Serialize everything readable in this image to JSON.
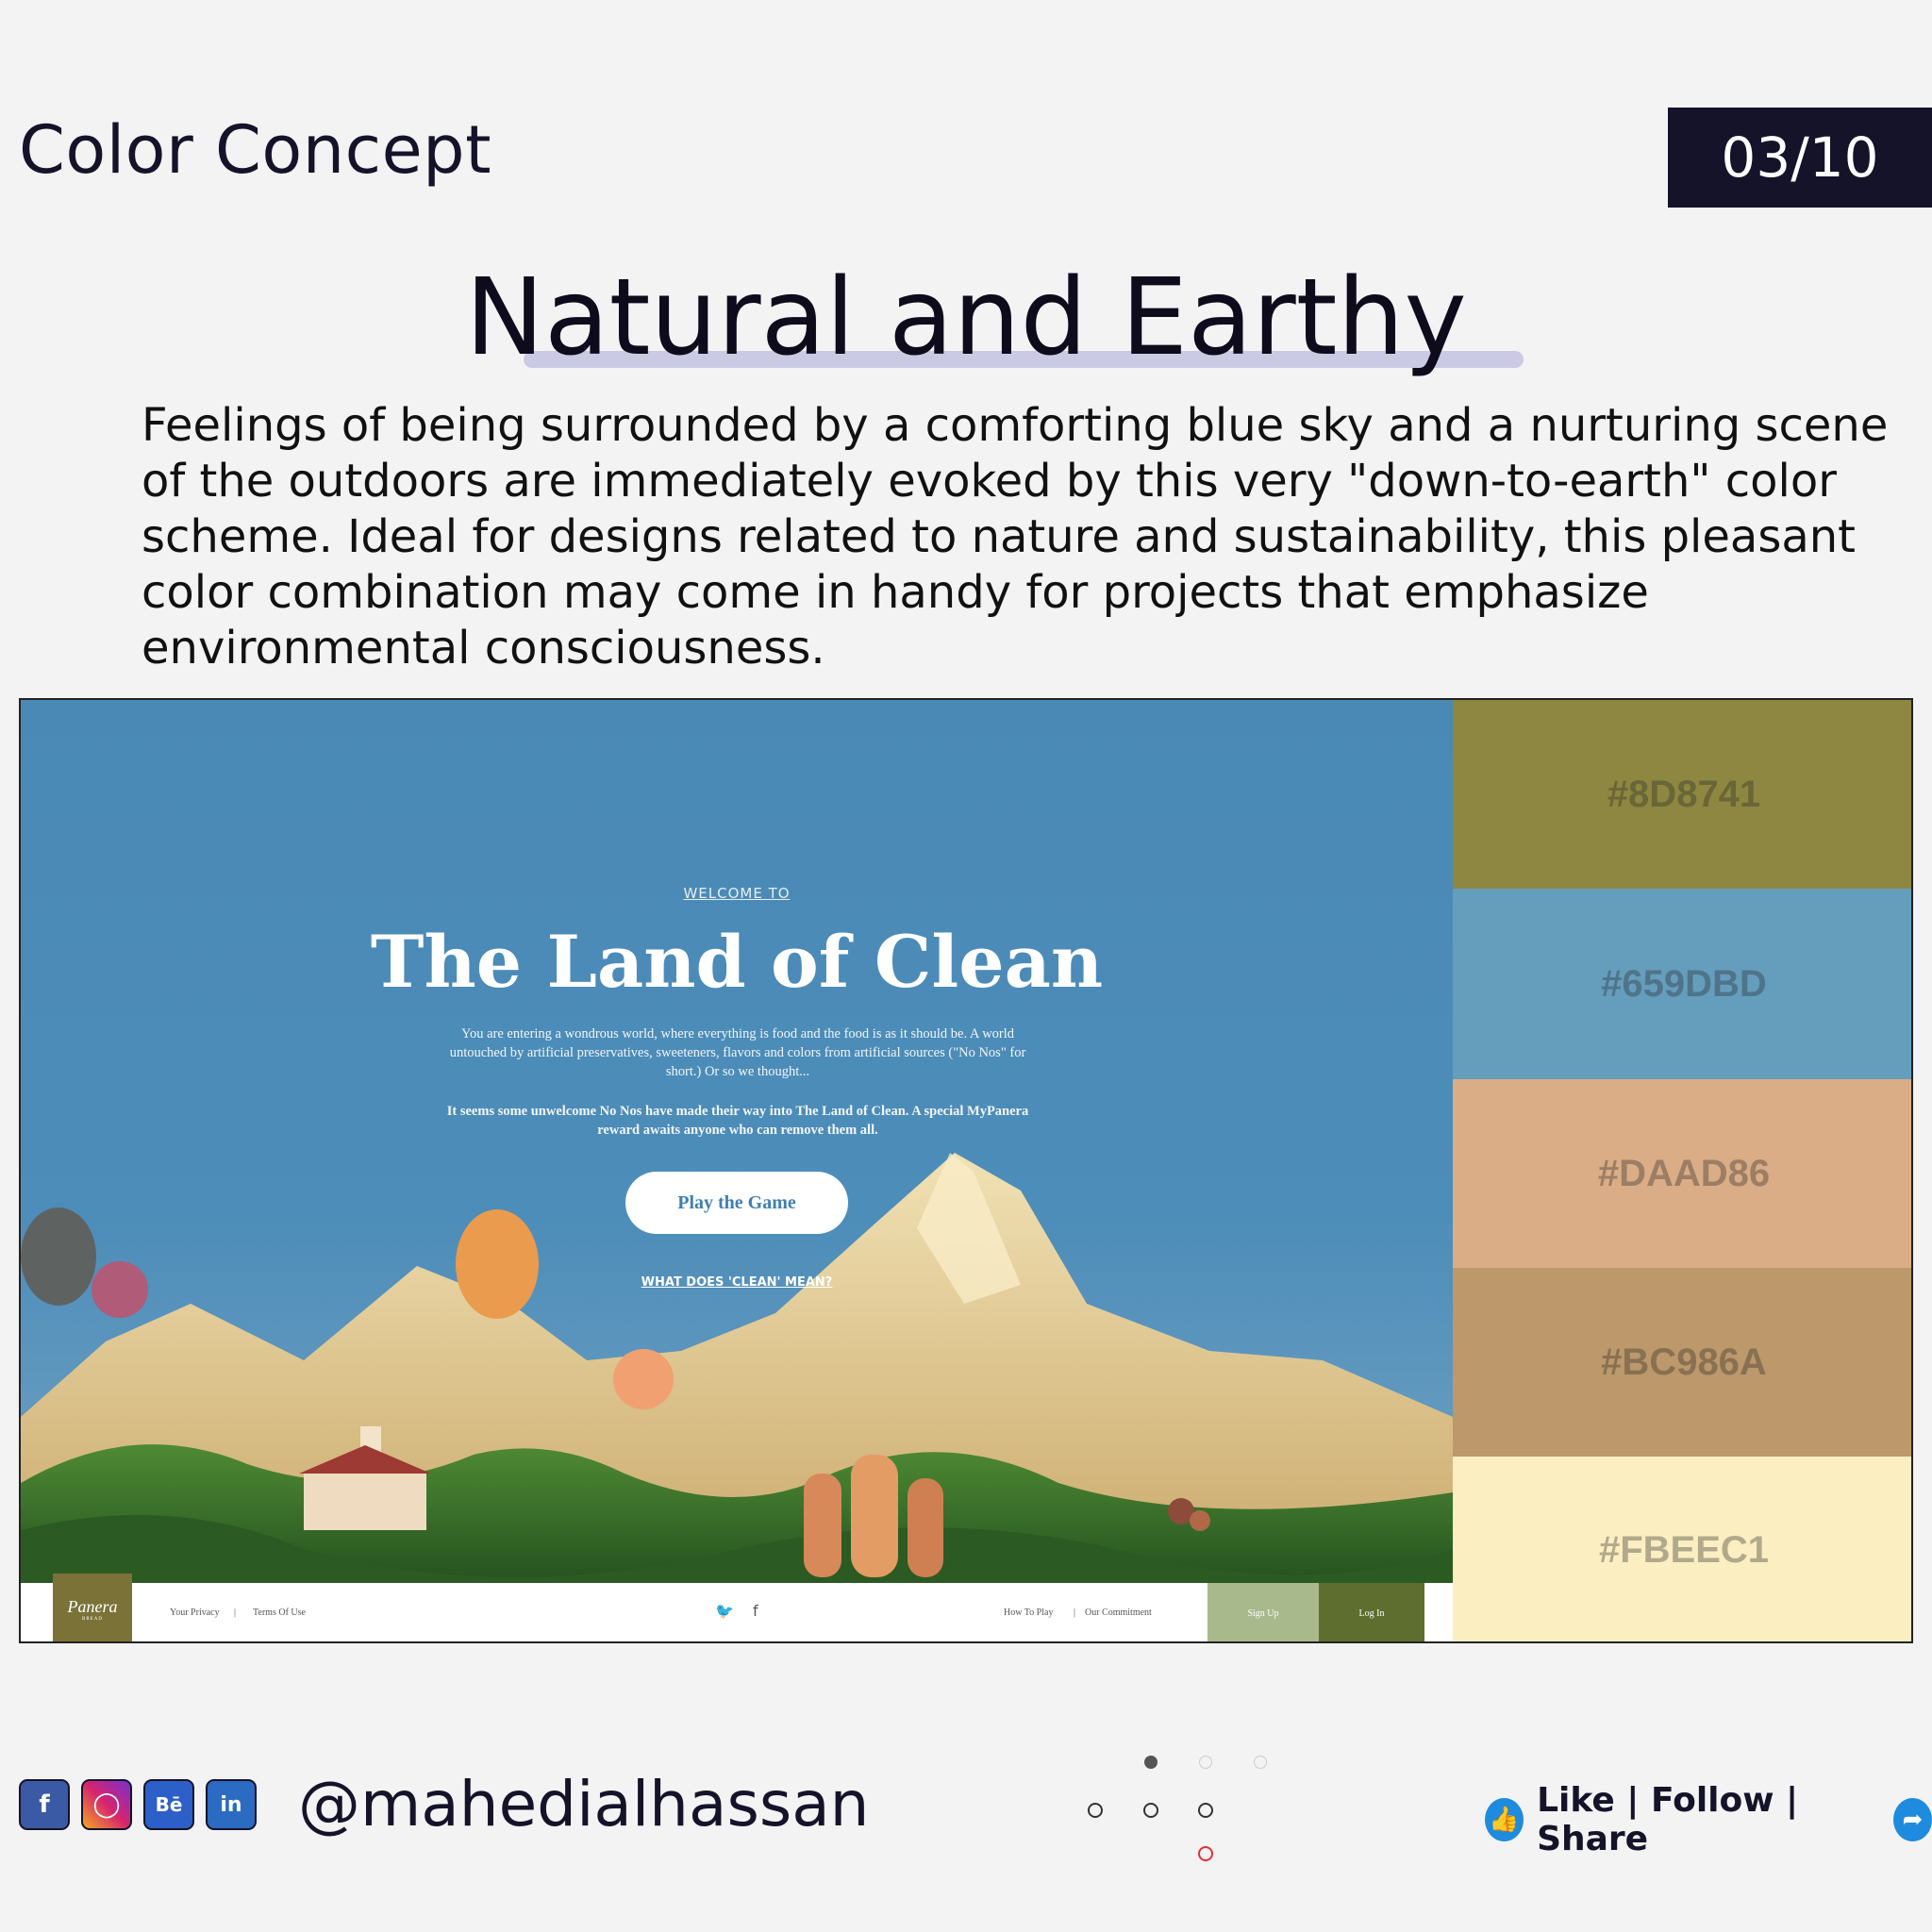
{
  "header": {
    "label": "Color Concept",
    "page_indicator": "03/10"
  },
  "title": "Natural and Earthy",
  "description": "Feelings of being surrounded by a comforting blue sky and a nurturing scene of the outdoors are immediately evoked by this very \"down-to-earth\" color scheme. Ideal for designs related to nature and sustainability, this pleasant color combination may come in handy for projects that emphasize environmental consciousness.",
  "showcase": {
    "welcome": "WELCOME TO",
    "hero_title": "The Land of Clean",
    "paragraph1": "You are entering a wondrous world, where everything is food and the food is as it should be. A world untouched by artificial preservatives, sweeteners, flavors and colors from artificial sources (\"No Nos\" for short.) Or so we thought...",
    "paragraph2": "It seems some unwelcome No Nos have made their way into The Land of Clean. A special MyPanera reward awaits anyone who can remove them all.",
    "play_button": "Play the Game",
    "clean_link": "WHAT DOES 'CLEAN' MEAN?",
    "footer": {
      "logo": "Panera",
      "logo_sub": "BREAD",
      "privacy": "Your Privacy",
      "terms": "Terms Of Use",
      "how_to_play": "How To Play",
      "commitment": "Our Commitment",
      "sign_up": "Sign Up",
      "log_in": "Log In",
      "icons": [
        "twitter-icon",
        "facebook-icon"
      ]
    }
  },
  "palette": [
    {
      "hex": "#8D8741",
      "color": "#8D8741"
    },
    {
      "hex": "#659DBD",
      "color": "#659DBD"
    },
    {
      "hex": "#DAAD86",
      "color": "#DAAD86"
    },
    {
      "hex": "#BC986A",
      "color": "#BC986A"
    },
    {
      "hex": "#FBEEC1",
      "color": "#FBEEC1"
    }
  ],
  "footer_bar": {
    "social_icons": [
      "facebook-icon",
      "instagram-icon",
      "behance-icon",
      "linkedin-icon"
    ],
    "handle": "@mahedialhassan",
    "cta": "Like | Follow | Share"
  }
}
